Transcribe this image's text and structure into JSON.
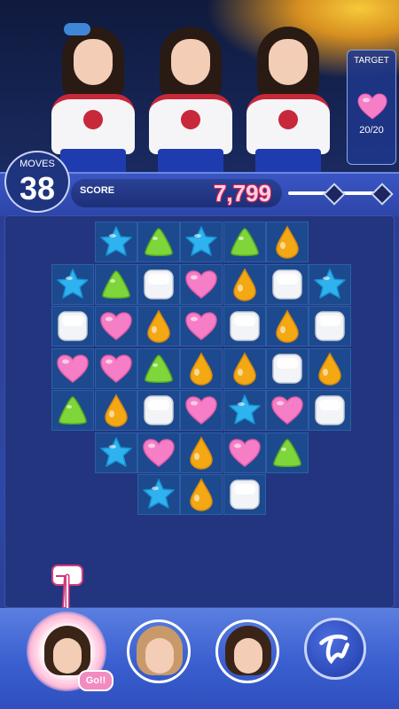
{
  "hud": {
    "moves_label": "MOVES",
    "moves_value": "38",
    "score_label": "SCORE",
    "score_value": "7,799",
    "target_label": "TARGET",
    "target_icon": "heart-icon",
    "target_count": "20/20"
  },
  "colors": {
    "star": "#2fb3f0",
    "triangle": "#7ed63a",
    "drop": "#f3a814",
    "heart": "#f57ec7",
    "square": "#f2f4f8",
    "board_cell": "#1d4a8e",
    "score_text": "#ffd0dd"
  },
  "board": {
    "rows": 7,
    "cols": 8,
    "cells": [
      [
        null,
        null,
        "star",
        "triangle",
        "star",
        "triangle",
        "drop",
        null
      ],
      [
        null,
        "star",
        "triangle",
        "square",
        "heart",
        "drop",
        "square",
        "star"
      ],
      [
        null,
        "square",
        "heart",
        "drop",
        "heart",
        "square",
        "drop",
        "square"
      ],
      [
        null,
        "heart",
        "heart",
        "triangle",
        "drop",
        "drop",
        "square",
        "drop"
      ],
      [
        null,
        "triangle",
        "drop",
        "square",
        "heart",
        "star",
        "heart",
        "square"
      ],
      [
        null,
        null,
        "star",
        "heart",
        "drop",
        "heart",
        "triangle",
        null
      ],
      [
        null,
        null,
        null,
        "star",
        "drop",
        "square",
        null,
        null
      ]
    ]
  },
  "bottom": {
    "go_badge": "Go!!",
    "team_button_icon": "twice-logo-icon"
  }
}
